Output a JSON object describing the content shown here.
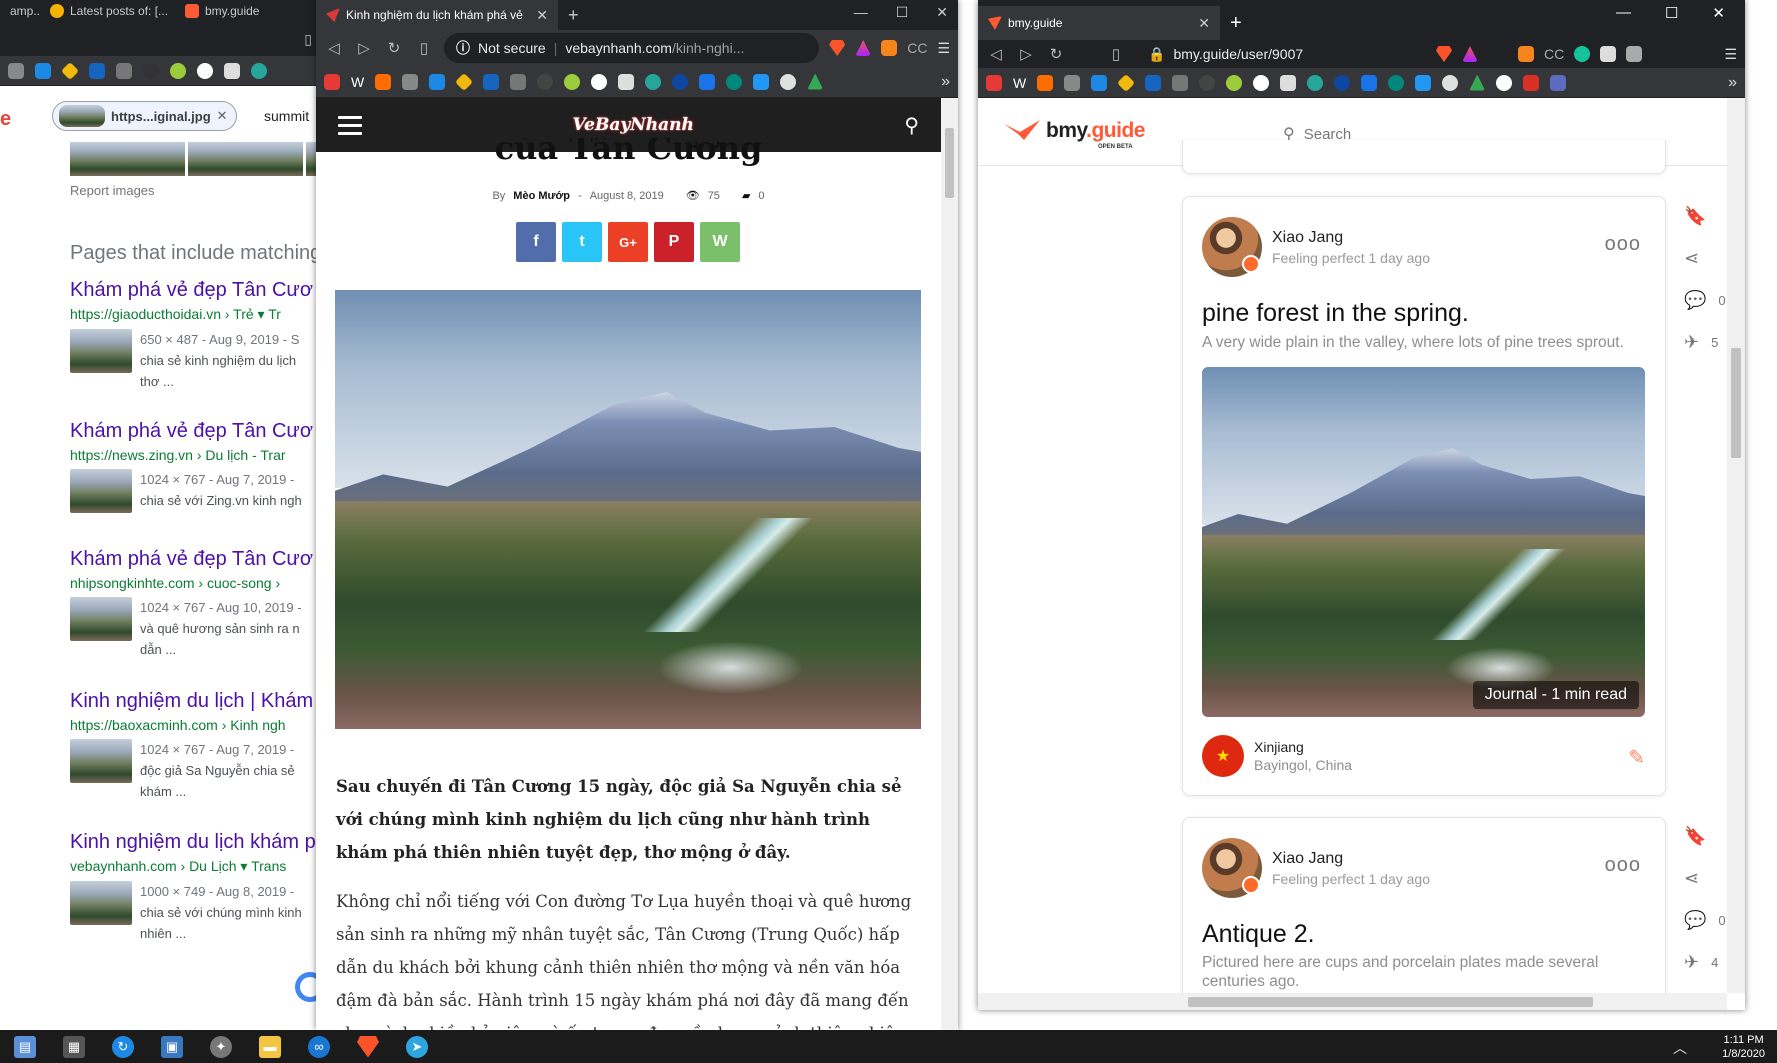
{
  "window_google": {
    "tabs": [
      {
        "label": "amp..."
      },
      {
        "label": "Latest posts of: [..."
      },
      {
        "label": "bmy.guide"
      }
    ],
    "search_chip": "https...iginal.jpg",
    "search_text": "summit",
    "report_images": "Report images",
    "pages_heading": "Pages that include matching",
    "results": [
      {
        "title": "Khám phá vẻ đẹp Tân Cươ",
        "url": "https://giaoducthoidai.vn › Trẻ ▾ Tr",
        "meta": "650 × 487 - Aug 9, 2019 - S",
        "snippet": "chia sẻ kinh nghiệm du lịch",
        "snippet2": "thơ ..."
      },
      {
        "title": "Khám phá vẻ đẹp Tân Cươ",
        "url": "https://news.zing.vn › Du lịch - Trar",
        "meta": "1024 × 767 - Aug 7, 2019 - ",
        "snippet": "chia sẻ với Zing.vn kinh ngh",
        "snippet2": ""
      },
      {
        "title": "Khám phá vẻ đẹp Tân Cươ",
        "url": "nhipsongkinhte.com › cuoc-song ›",
        "meta": "1024 × 767 - Aug 10, 2019 -",
        "snippet": "và quê hương sản sinh ra n",
        "snippet2": "dẫn ..."
      },
      {
        "title": "Kinh nghiệm du lịch | Khám",
        "url": "https://baoxacminh.com › Kinh ngh",
        "meta": "1024 × 767 - Aug 7, 2019 - ",
        "snippet": "độc giả Sa Nguyễn chia sẻ",
        "snippet2": "khám ..."
      },
      {
        "title": "Kinh nghiệm du lịch khám p",
        "url": "vebaynhanh.com › Du Lịch ▾ Trans",
        "meta": "1000 × 749 - Aug 8, 2019 - ",
        "snippet": "chia sẻ với chúng mình kinh",
        "snippet2": "nhiên ..."
      }
    ]
  },
  "window_article": {
    "tab_title": "Kinh nghiệm du lịch khám phá vẻ",
    "not_secure": "Not secure",
    "url_host": "vebaynhanh.com",
    "url_path": "/kinh-nghi...",
    "logo": "VeBayNhanh",
    "title_fragment": "của Tân Cương",
    "by": "By",
    "author": "Mèo Mướp",
    "date": "August 8, 2019",
    "views": "75",
    "comments": "0",
    "share": {
      "facebook": "f",
      "twitter": "t",
      "googleplus": "G+",
      "pinterest": "P",
      "whatsapp": "W"
    },
    "lead": "Sau chuyến đi Tân Cương 15 ngày, độc giả Sa Nguyễn chia sẻ với chúng mình kinh nghiệm du lịch cũng như hành trình khám phá thiên nhiên tuyệt đẹp, thơ mộng ở đây.",
    "paragraph": "Không chỉ nổi tiếng với Con đường Tơ Lụa huyền thoại và quê hương sản sinh ra những mỹ nhân tuyệt sắc, Tân Cương (Trung Quốc) hấp dẫn du khách bởi khung cảnh thiên nhiên thơ mộng và nền văn hóa đậm đà bản sắc. Hành trình 15 ngày khám phá nơi đây đã mang đến cho mình nhiều kỷ niệm và ấn tượng đẹp về phong cảnh thiên nhiên và con người. Tân"
  },
  "window_bmy": {
    "tab_title": "bmy.guide",
    "url": "bmy.guide/user/9007",
    "logo_main": "bmy",
    "logo_tail": ".guide",
    "logo_beta": "OPEN BETA",
    "search_placeholder": "Search",
    "posts": [
      {
        "author": "Xiao Jang",
        "status": "Feeling perfect",
        "time": "1 day ago",
        "title": "pine forest in the spring.",
        "desc": "A very wide plain in the valley, where lots of pine trees sprout.",
        "badge": "Journal - 1 min read",
        "location": "Xinjiang",
        "region": "Bayingol, China",
        "comments": "0",
        "likes": "5"
      },
      {
        "author": "Xiao Jang",
        "status": "Feeling perfect",
        "time": "1 day ago",
        "title": "Antique 2.",
        "desc": "Pictured here are cups and porcelain plates made several centuries ago.",
        "comments": "0",
        "likes": "4"
      }
    ]
  },
  "taskbar": {
    "time": "1:11 PM",
    "date": "1/8/2020"
  },
  "colors": {
    "chrome_dark": "#202124",
    "chrome_toolbar": "#35363a",
    "brand_orange": "#ff5a36",
    "link_purple": "#4b11a8",
    "url_green": "#0a7c33"
  }
}
